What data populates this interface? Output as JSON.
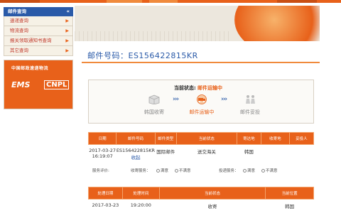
{
  "sidebar": {
    "header": "邮件查询",
    "items": [
      {
        "label": "速递查询"
      },
      {
        "label": "物流查询"
      },
      {
        "label": "报关领取通知书查询"
      },
      {
        "label": "其它查询"
      }
    ],
    "ems_card": {
      "org": "中国邮政速递物流",
      "ems": "EMS",
      "cnpl": "CNPL",
      "slogan": ""
    }
  },
  "page": {
    "title": "邮件号码：ES156422815KR"
  },
  "status": {
    "current_label": "当前状态:",
    "current_value": "邮件运输中",
    "steps": [
      {
        "label": "韩国收寄",
        "icon": "box-icon",
        "active": false
      },
      {
        "label": "邮件运输中",
        "icon": "truck-icon",
        "active": true
      },
      {
        "label": "邮件妥投",
        "icon": "delivery-icon",
        "active": false
      }
    ]
  },
  "mail_table": {
    "headers": [
      "日期",
      "邮件号码",
      "邮件类型",
      "当前状态",
      "寄达地",
      "收寄地",
      "妥投人"
    ],
    "row": [
      "2017-03-27 16:19:07",
      "ES156422815KR",
      "国际邮件",
      "送交海关",
      "韩国",
      "",
      ""
    ],
    "link_label": "收起"
  },
  "service": {
    "label": "服务评价:",
    "receive_label": "收寄服务：",
    "deliver_label": "投递服务：",
    "options": [
      "满意",
      "不满意"
    ]
  },
  "trace_table": {
    "headers": [
      "处理日期",
      "处理时间",
      "当前状态",
      "当前位置"
    ],
    "rows": [
      [
        "2017-03-23",
        "19:20:00",
        "收寄",
        "韩国"
      ]
    ]
  },
  "colors": {
    "accent": "#e8611a",
    "brand_blue": "#2a5aa8"
  }
}
